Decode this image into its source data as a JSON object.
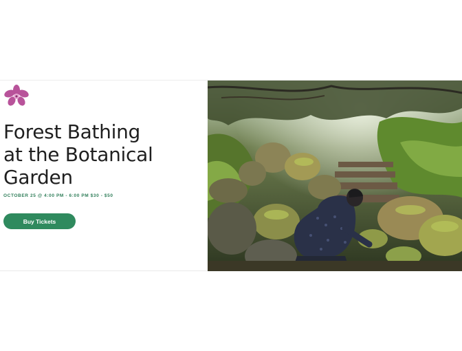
{
  "event": {
    "title_lines": [
      "Forest Bathing",
      "at the Botanical",
      "Garden"
    ],
    "meta": "OCTOBER 25 @ 4:00 PM - 6:00 PM  $30 - $50",
    "buy_label": "Buy Tickets"
  },
  "brand": {
    "logo_icon": "orchid-flower-icon",
    "logo_color": "#b8539a"
  },
  "colors": {
    "accent": "#2f8a5e",
    "title_text": "#1f1f1f",
    "meta_text": "#2e7d58"
  },
  "photo": {
    "icon": "forest-garden-photo"
  }
}
